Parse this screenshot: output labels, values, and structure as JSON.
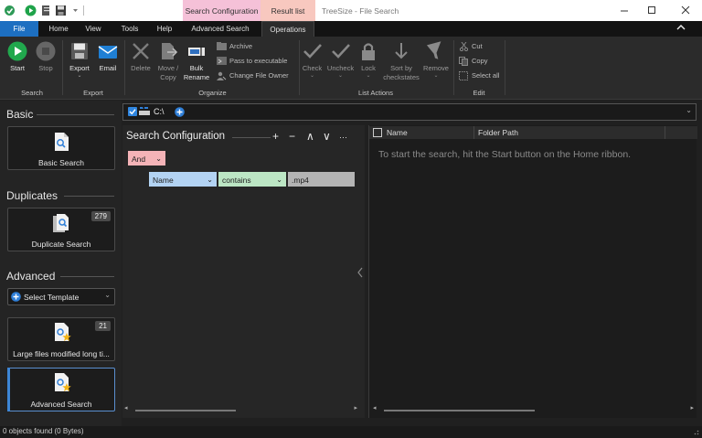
{
  "titlebar": {
    "app_title": "TreeSize - File Search",
    "context_tabs": [
      "Search Configuration",
      "Result list"
    ],
    "context_colors": {
      "search_config": "#f5c1d8",
      "result_list": "#f8c8bf"
    }
  },
  "ribbon_tabs": [
    "File",
    "Home",
    "View",
    "Tools",
    "Help",
    "Advanced Search",
    "Operations"
  ],
  "ribbon": {
    "search": {
      "label": "Search",
      "start": "Start",
      "stop": "Stop"
    },
    "export": {
      "label": "Export",
      "export": "Export",
      "email": "Email"
    },
    "organize": {
      "label": "Organize",
      "delete": "Delete",
      "move_copy": [
        "Move /",
        "Copy"
      ],
      "bulk_rename": [
        "Bulk",
        "Rename"
      ],
      "archive": "Archive",
      "pass_exec": "Pass to executable",
      "change_owner": "Change File Owner"
    },
    "list_actions": {
      "label": "List Actions",
      "check": "Check",
      "uncheck": "Uncheck",
      "lock": "Lock",
      "sort": [
        "Sort by",
        "checkstates"
      ],
      "remove": "Remove"
    },
    "edit": {
      "label": "Edit",
      "cut": "Cut",
      "copy": "Copy",
      "select_all": "Select all"
    }
  },
  "left": {
    "basic_title": "Basic",
    "basic_search": "Basic Search",
    "duplicates_title": "Duplicates",
    "duplicate_search": "Duplicate Search",
    "duplicate_count": "279",
    "advanced_title": "Advanced",
    "select_template": "Select Template",
    "large_files": "Large files modified long ti...",
    "large_files_count": "21",
    "advanced_search": "Advanced Search"
  },
  "path": {
    "drive": "C:\\"
  },
  "config": {
    "title": "Search Configuration",
    "tools": [
      "+",
      "−",
      "∧",
      "∨",
      "···"
    ],
    "logic": "And",
    "field": "Name",
    "operator": "contains",
    "value": ".mp4"
  },
  "results": {
    "columns": [
      "Name",
      "Folder Path"
    ],
    "hint": "To start the search, hit the Start button on the Home ribbon."
  },
  "status": "0 objects found (0 Bytes)"
}
